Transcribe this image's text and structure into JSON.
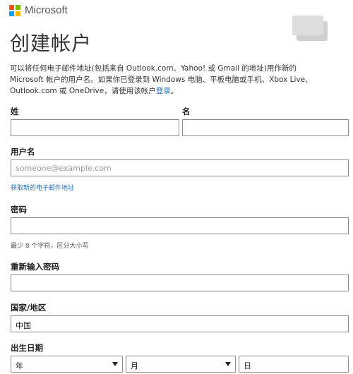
{
  "brand": {
    "name": "Microsoft",
    "colors": [
      "#f25022",
      "#7fba00",
      "#00a4ef",
      "#ffb900"
    ]
  },
  "page": {
    "title": "创建帐户",
    "intro_line1": "可以将任何电子邮件地址(包括来自 Outlook.com、Yahoo! 或 Gmail 的地址)用作新的",
    "intro_line2": "Microsoft 帐户的用户名。如果你已登录到 Windows 电脑、平板电脑或手机、Xbox Live、",
    "intro_line3_pre": "Outlook.com 或 OneDrive，请使用该帐户",
    "intro_link": "登录",
    "intro_line3_post": "。"
  },
  "form": {
    "last_name_label": "姓",
    "first_name_label": "名",
    "username_label": "用户名",
    "username_placeholder": "someone@example.com",
    "new_email_link": "获取新的电子邮件地址",
    "password_label": "密码",
    "password_hint": "最少 8 个字符，区分大小写",
    "reenter_password_label": "重新输入密码",
    "country_label": "国家/地区",
    "country_value": "中国",
    "birthdate_label": "出生日期",
    "year_label": "年",
    "month_label": "月",
    "day_label": "日"
  }
}
